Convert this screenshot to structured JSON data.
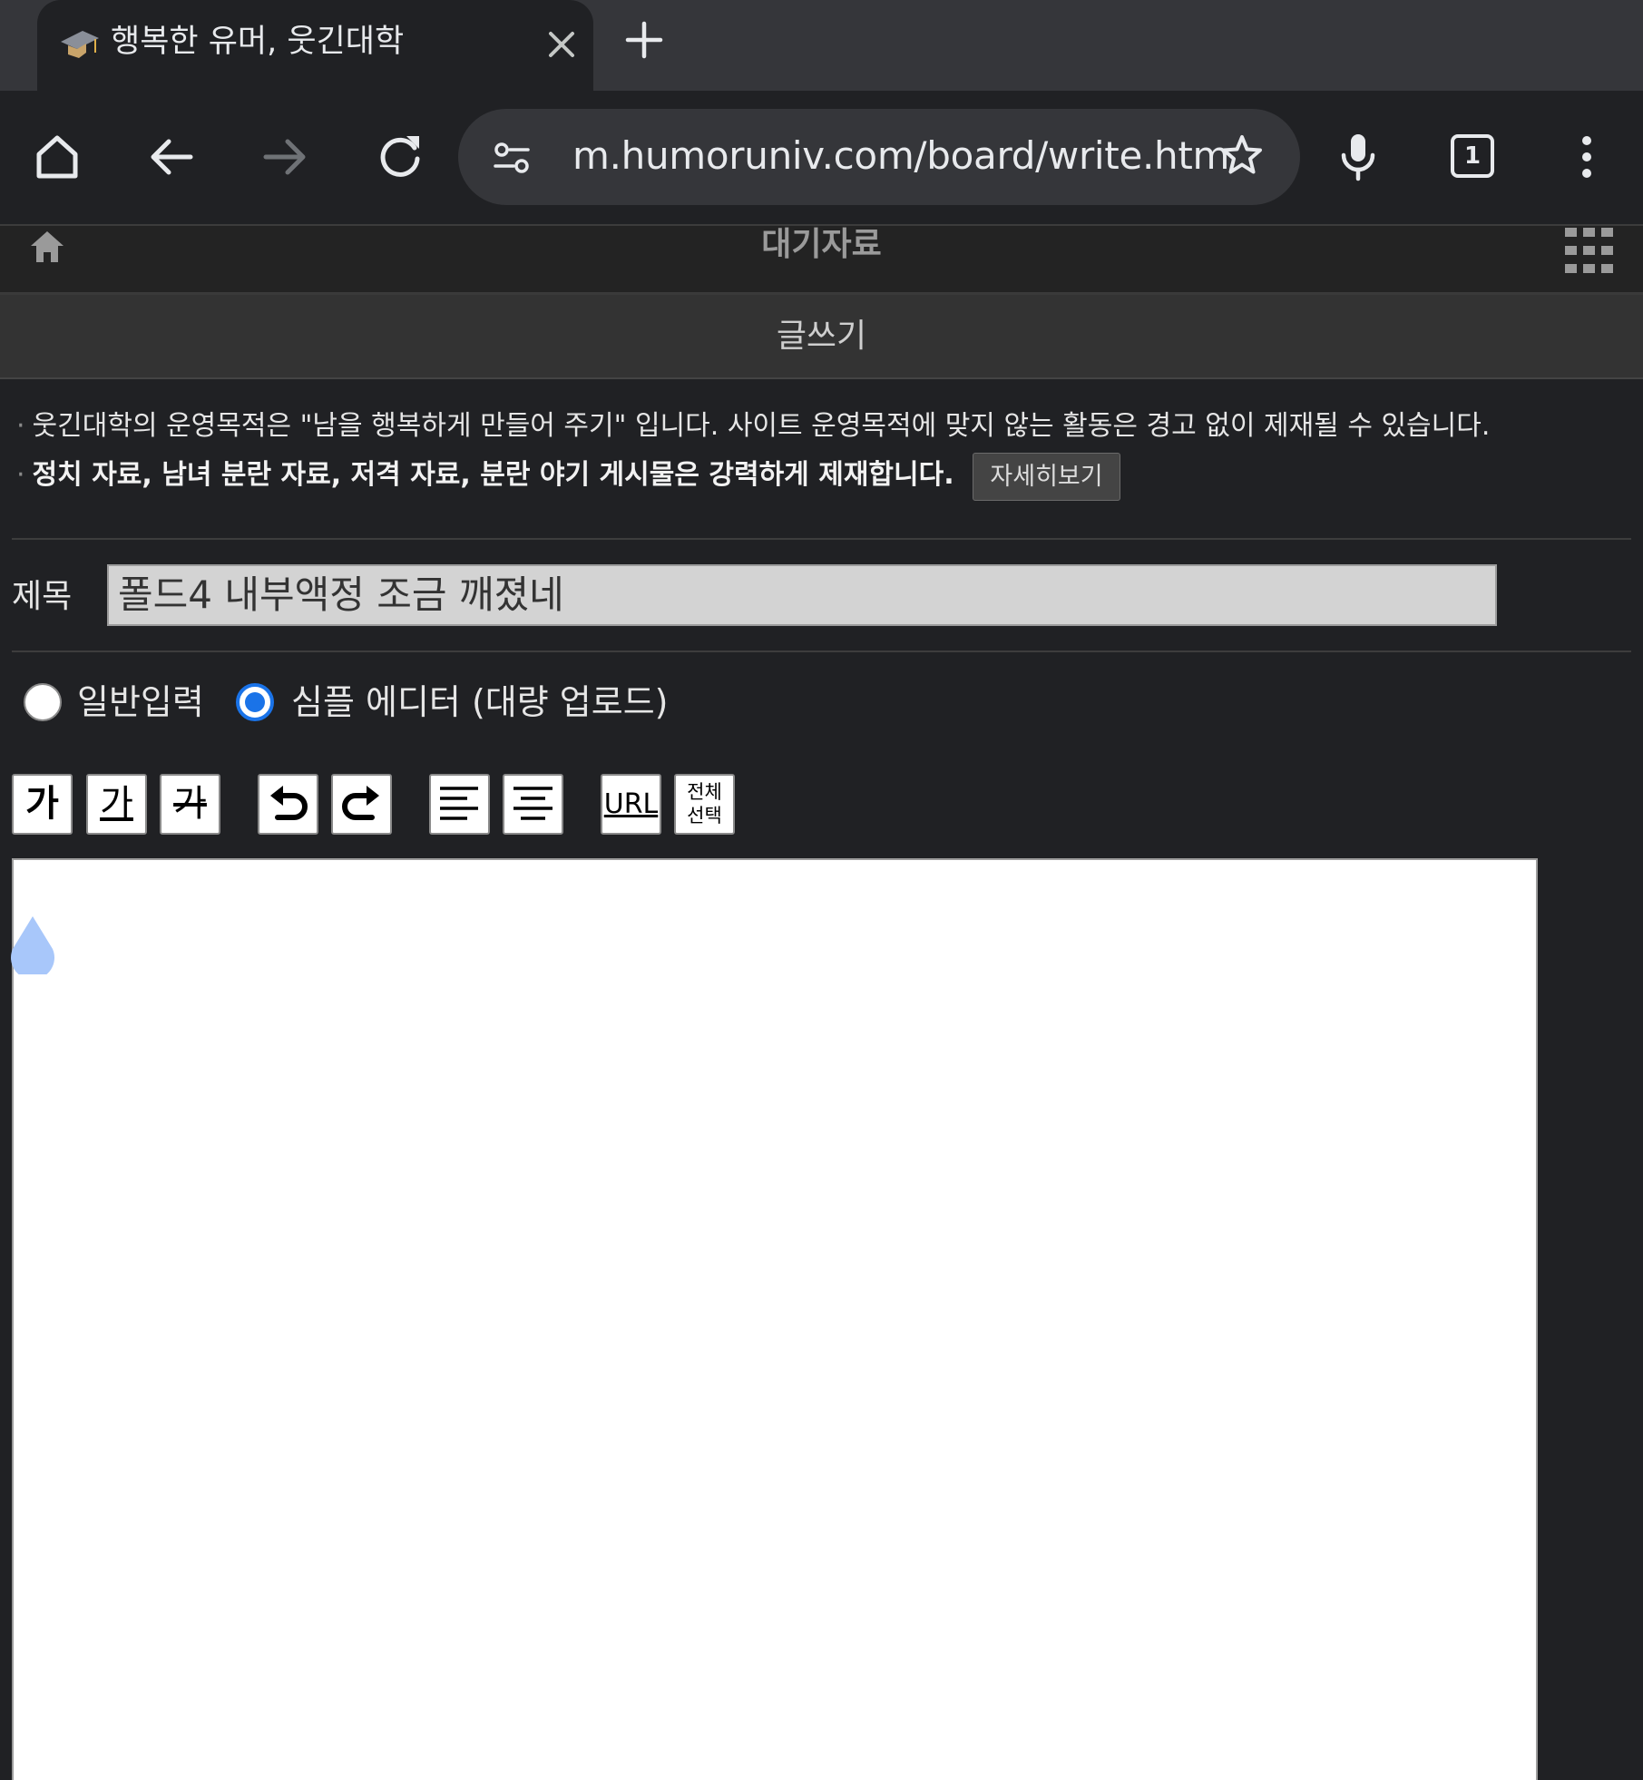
{
  "browser": {
    "tab_title": "행복한 유머, 웃긴대학",
    "url": "m.humoruniv.com/board/write.htm",
    "tab_count": "1",
    "icons": [
      "graduation-cap-favicon",
      "close-icon",
      "plus-icon",
      "home-icon",
      "back-arrow-icon",
      "forward-arrow-icon",
      "reload-icon",
      "tune-icon",
      "star-icon",
      "mic-icon",
      "more-vert-icon"
    ]
  },
  "site": {
    "section_title": "대기자료",
    "page_title": "글쓰기"
  },
  "notice": {
    "line1": "웃긴대학의 운영목적은 \"남을 행복하게 만들어 주기\" 입니다. 사이트 운영목적에 맞지 않는 활동은 경고 없이 제재될 수 있습니다.",
    "line2": "정치 자료, 남녀 분란 자료, 저격 자료, 분란 야기 게시물은 강력하게 제재합니다.",
    "detail_button": "자세히보기"
  },
  "form": {
    "subject_label": "제목",
    "subject_value": "폴드4 내부액정 조금 깨졌네",
    "mode_options": [
      {
        "label": "일반입력",
        "selected": false
      },
      {
        "label": "심플 에디터 (대량 업로드)",
        "selected": true
      }
    ]
  },
  "editor_toolbar": {
    "bold": "가",
    "underline": "가",
    "strike": "가",
    "url": "URL",
    "select_all_line1": "전체",
    "select_all_line2": "선택"
  },
  "colors": {
    "accent": "#1a73e8",
    "page_bg": "#202124",
    "subject_bg": "#d3d3d3",
    "caret_handle": "#a8c7fa"
  }
}
